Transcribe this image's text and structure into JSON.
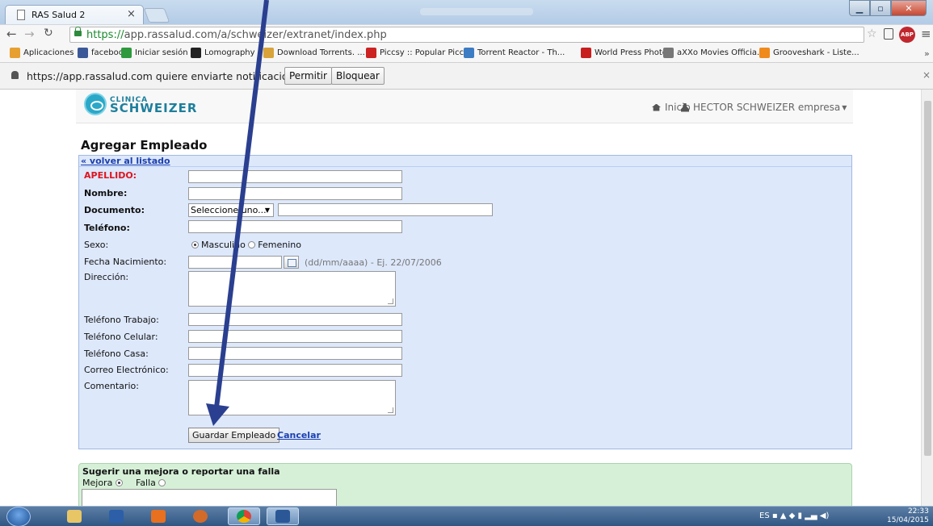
{
  "browser": {
    "tab_title": "RAS Salud 2",
    "url_secure": "https://",
    "url_rest": "app.rassalud.com/a/schweizer/extranet/index.php",
    "bookmarks": [
      {
        "label": "Aplicaciones",
        "color": "#e7a02f"
      },
      {
        "label": "facebook",
        "color": "#3b5998"
      },
      {
        "label": "Iniciar sesión",
        "color": "#2e9a3d"
      },
      {
        "label": "Lomography",
        "color": "#222222"
      },
      {
        "label": "Download Torrents. ...",
        "color": "#d9a33b"
      },
      {
        "label": "Piccsy :: Popular Piccs",
        "color": "#cc2222"
      },
      {
        "label": "Torrent Reactor - Th...",
        "color": "#3c7cc4"
      },
      {
        "label": "World Press Photo",
        "color": "#c81e1e"
      },
      {
        "label": "aXXo Movies Officia...",
        "color": "#777777"
      },
      {
        "label": "Grooveshark - Liste...",
        "color": "#f08a1c"
      }
    ],
    "notification": {
      "message": "https://app.rassalud.com quiere enviarte notificaciones.",
      "allow": "Permitir",
      "block": "Bloquear"
    }
  },
  "site": {
    "logo_line1": "CLINICA",
    "logo_line2": "SCHWEIZER",
    "nav_home": "Inicio",
    "nav_user": "HECTOR SCHWEIZER empresa"
  },
  "form": {
    "title": "Agregar Empleado",
    "back_link": "« volver al listado",
    "fields": {
      "apellido": "APELLIDO:",
      "nombre": "Nombre:",
      "documento": "Documento:",
      "telefono": "Teléfono:",
      "sexo": "Sexo:",
      "fecha": "Fecha Nacimiento:",
      "direccion": "Dirección:",
      "tel_trabajo": "Teléfono Trabajo:",
      "tel_celular": "Teléfono Celular:",
      "tel_casa": "Teléfono Casa:",
      "correo": "Correo Electrónico:",
      "comentario": "Comentario:"
    },
    "doc_select": "Seleccione uno...",
    "sexo_masculino": "Masculino",
    "sexo_femenino": "Femenino",
    "date_hint": "(dd/mm/aaaa) - Ej. 22/07/2006",
    "save": "Guardar Empleado",
    "cancel": "Cancelar"
  },
  "suggest": {
    "title": "Sugerir una mejora o reportar una falla",
    "mejora": "Mejora",
    "falla": "Falla"
  },
  "taskbar": {
    "lang": "ES",
    "time": "22:33",
    "date": "15/04/2015"
  },
  "colors": {
    "form_bg": "#dde8fb",
    "required_red": "#e0141e",
    "link_blue": "#1a3fb0",
    "suggest_bg": "#d6f0d8",
    "arrow": "#2a3f8f"
  }
}
